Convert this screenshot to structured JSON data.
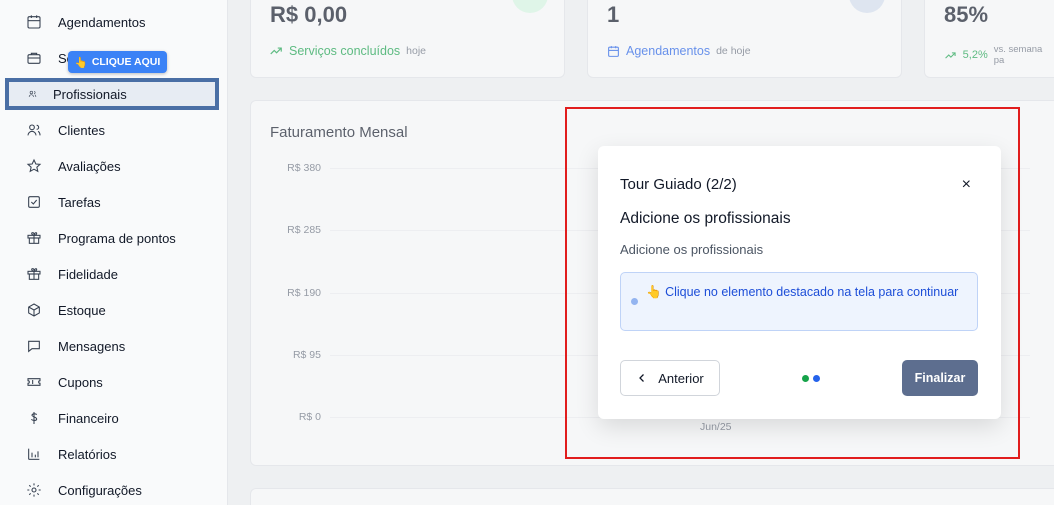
{
  "sidebar": {
    "items": [
      {
        "label": "Agendamentos",
        "icon": "calendar-icon"
      },
      {
        "label": "Se",
        "icon": "briefcase-icon"
      },
      {
        "label": "Profissionais",
        "icon": "users-icon"
      },
      {
        "label": "Clientes",
        "icon": "users-icon"
      },
      {
        "label": "Avaliações",
        "icon": "star-icon"
      },
      {
        "label": "Tarefas",
        "icon": "checkbox-icon"
      },
      {
        "label": "Programa de pontos",
        "icon": "gift-icon"
      },
      {
        "label": "Fidelidade",
        "icon": "gift-icon"
      },
      {
        "label": "Estoque",
        "icon": "box-icon"
      },
      {
        "label": "Mensagens",
        "icon": "message-icon"
      },
      {
        "label": "Cupons",
        "icon": "ticket-icon"
      },
      {
        "label": "Financeiro",
        "icon": "dollar-icon"
      },
      {
        "label": "Relatórios",
        "icon": "bar-chart-icon"
      },
      {
        "label": "Configurações",
        "icon": "gear-icon"
      }
    ],
    "click_badge": {
      "emoji": "👆",
      "label": "CLIQUE AQUI"
    }
  },
  "stats": [
    {
      "value": "R$ 0,00",
      "sub_label": "Serviços concluídos",
      "sub_note": "hoje",
      "sub_color": "#16a34a"
    },
    {
      "value": "1",
      "sub_label": "Agendamentos",
      "sub_note": "de hoje",
      "sub_color": "#2563eb"
    },
    {
      "value": "85%",
      "sub_label": "5,2%",
      "sub_note": "vs. semana pa",
      "sub_color": "#16a34a"
    }
  ],
  "chart_data": {
    "type": "bar",
    "title": "Faturamento Mensal",
    "categories": [
      "Jun/25"
    ],
    "yticks": [
      "R$ 380",
      "R$ 285",
      "R$ 190",
      "R$ 95",
      "R$ 0"
    ],
    "ylim": [
      0,
      380
    ],
    "values": [
      0
    ]
  },
  "tour": {
    "title": "Tour Guiado (2/2)",
    "close": "×",
    "heading": "Adicione os profissionais",
    "description": "Adicione os profissionais",
    "hint_emoji": "👆",
    "hint_text": "Clique no elemento destacado na tela para continuar",
    "prev_label": "Anterior",
    "finish_label": "Finalizar",
    "step_colors": [
      "#16a34a",
      "#2563eb"
    ]
  }
}
